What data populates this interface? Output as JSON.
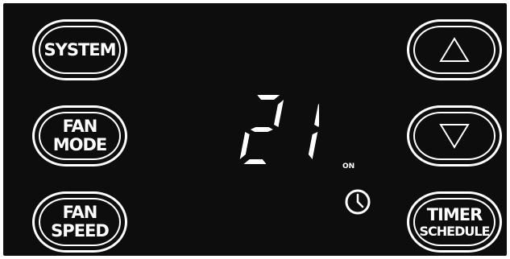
{
  "controls": {
    "system_label": "SYSTEM",
    "fan_mode": {
      "line1": "FAN",
      "line2": "MODE"
    },
    "fan_speed": {
      "line1": "FAN",
      "line2": "SPEED"
    },
    "timer_schedule": {
      "line1": "TIMER",
      "line2": "SCHEDULE"
    },
    "up_icon": "triangle-up-icon",
    "down_icon": "triangle-down-icon"
  },
  "display": {
    "temperature": "21",
    "on_indicator": "ON",
    "timer_icon": "clock-icon"
  },
  "colors": {
    "background": "#0d0d0d",
    "foreground": "#ffffff"
  }
}
